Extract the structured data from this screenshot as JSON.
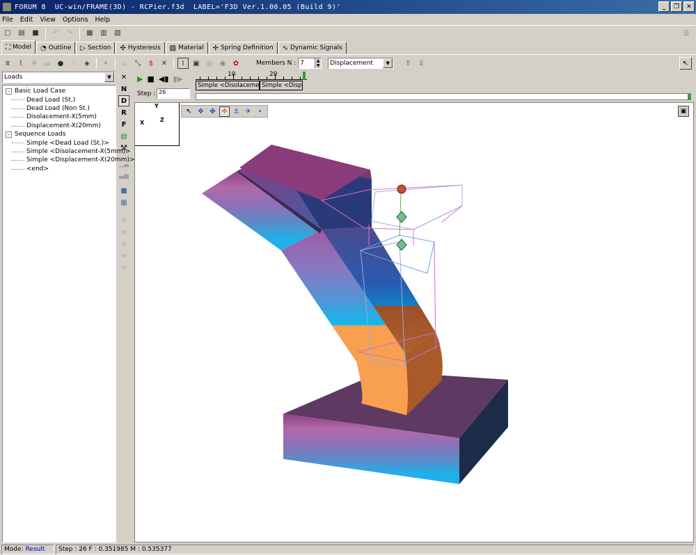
{
  "window": {
    "title": "FORUM 8  UC-win/FRAME(3D) - RCPier.f3d  LABEL='F3D Ver.1.00.05 (Build 9)'"
  },
  "menu": [
    "File",
    "Edit",
    "View",
    "Options",
    "Help"
  ],
  "tabs": [
    "Model",
    "Outline",
    "Section",
    "Hysteresis",
    "Material",
    "Spring Definition",
    "Dynamic Signals"
  ],
  "members": {
    "label": "Members N :",
    "value": "7"
  },
  "result_select": {
    "value": "Displacement"
  },
  "left": {
    "select": "Loads",
    "tree": [
      {
        "label": "Basic Load Case",
        "level": 1,
        "toggle": "-"
      },
      {
        "label": "Dead Load (St.)",
        "level": 2
      },
      {
        "label": "Dead Load (Non St.)",
        "level": 2
      },
      {
        "label": "Disolacement-X(5mm)",
        "level": 2
      },
      {
        "label": "Displacement-X(20mm)",
        "level": 2
      },
      {
        "label": "Sequence Loads",
        "level": 1,
        "toggle": "-"
      },
      {
        "label": "Simple <Dead Load (St.)>",
        "level": 2
      },
      {
        "label": "Simple <Disolacement-X(5mm)>",
        "level": 2
      },
      {
        "label": "Simple <Displacement-X(20mm)>",
        "level": 2
      },
      {
        "label": "<end>",
        "level": 2
      }
    ]
  },
  "side_toolbar": [
    "N",
    "D",
    "R",
    "F"
  ],
  "animation": {
    "step_label": "Step :",
    "step_value": "26",
    "ruler": [
      "10",
      "20"
    ],
    "segments": [
      "Simple <Disolacement-X(",
      "Simple <Displac"
    ],
    "progress_color": "#4a7bd0"
  },
  "axes": {
    "y": "Y",
    "x": "X",
    "z": "Z"
  },
  "status": {
    "mode_label": "Mode:",
    "mode_value": "Result",
    "step_info": "Step : 26  F : 0.351985  M : 0.535377"
  },
  "colors": {
    "accent": "#0a246a",
    "result": "#0000c0"
  }
}
